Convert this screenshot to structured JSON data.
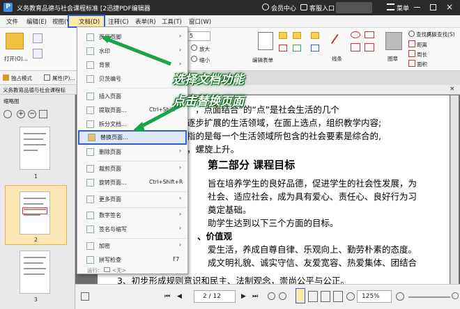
{
  "titlebar": {
    "app_icon": "P",
    "title": "义务教育品德与社会课程标准 [2迅捷PDF编辑器",
    "member": "会员中心",
    "login": "客服入口",
    "menu": "菜单"
  },
  "menubar": {
    "items": [
      "文件",
      "编辑(E)",
      "视图(V)",
      "文档(D)",
      "注释(C)",
      "表单(R)",
      "工具(T)",
      "窗口(W)"
    ]
  },
  "ribbon": {
    "open": "打开(O)...",
    "zoom_value": "5",
    "enlarge": "放大",
    "shrink": "缩小",
    "edit_content": "编辑表单",
    "line": "线条",
    "stamp": "图章",
    "find": "查找(F)",
    "adv_find": "高级查找(S)",
    "distance": "距离",
    "perimeter": "周长",
    "area": "面积"
  },
  "quickbar": {
    "exclusive_mode": "独占模式",
    "properties": "属性(P)..."
  },
  "doc_tab": {
    "label": "义务教育品德与社会课程标"
  },
  "left_panel": {
    "title": "缩略图",
    "page_nums": [
      "1",
      "2",
      "3"
    ]
  },
  "dropdown": {
    "items": [
      {
        "label": "页眉页脚",
        "shortcut": "",
        "arrow": true
      },
      {
        "label": "水印",
        "shortcut": "",
        "arrow": true
      },
      {
        "label": "背景",
        "shortcut": "",
        "arrow": true
      },
      {
        "label": "贝茨编号",
        "shortcut": "",
        "arrow": true
      },
      {
        "label": "插入页面",
        "shortcut": "",
        "arrow": true
      },
      {
        "label": "提取页面...",
        "shortcut": "Ctrl+Shift",
        "arrow": false
      },
      {
        "label": "拆分文档...",
        "shortcut": "",
        "arrow": false
      },
      {
        "label": "替换页面...",
        "shortcut": "",
        "arrow": false
      },
      {
        "label": "删除页面",
        "shortcut": "",
        "arrow": true
      },
      {
        "label": "裁剪页面",
        "shortcut": "",
        "arrow": true
      },
      {
        "label": "旋转页面...",
        "shortcut": "Ctrl+Shift+R",
        "arrow": false
      },
      {
        "label": "更多页面",
        "shortcut": "",
        "arrow": true
      },
      {
        "label": "数字签名",
        "shortcut": "",
        "arrow": true
      },
      {
        "label": "签名与缩写",
        "shortcut": "",
        "arrow": true
      },
      {
        "label": "加密",
        "shortcut": "",
        "arrow": true
      },
      {
        "label": "拼写检查",
        "shortcut": "F7",
        "arrow": false
      }
    ],
    "run_label": "运行:",
    "run_value": "<无>"
  },
  "callout": {
    "line1": "选择文档功能",
    "line2": "点击替换页面"
  },
  "document": {
    "lines": [
      "，点面结合”的“点”是社会生活的几个",
      "逐步扩展的生活领域，在面上选点，组织教学内容;",
      "指的是每一个生活领域所包含的社会要素是综合的,",
      "，螺旋上升。",
      "第二部分   课程目标",
      "旨在培养学生的良好品德，促进学生的社会性发展，为",
      "社会、适应社会，成为具有爱心、责任心、良好行为习",
      "奠定基础。",
      "助学生达到以下三个方面的目标。",
      "、价值观",
      "爱生活，养成自尊自律、乐观向上、勤劳朴素的态度。",
      "成文明礼貌、诚实守信、友爱宽容、热爱集体、团结合",
      "3、初步形成规则意识和民主、法制观念，崇尚公平与公正。"
    ]
  },
  "statusbar": {
    "page": "2 / 12",
    "zoom": "125%"
  },
  "colors": {
    "titlebar": "#2b2b2b",
    "highlight": "#2d5fd6",
    "callout_glow": "#0a6b1d",
    "menu_active": "#fde9a8"
  }
}
